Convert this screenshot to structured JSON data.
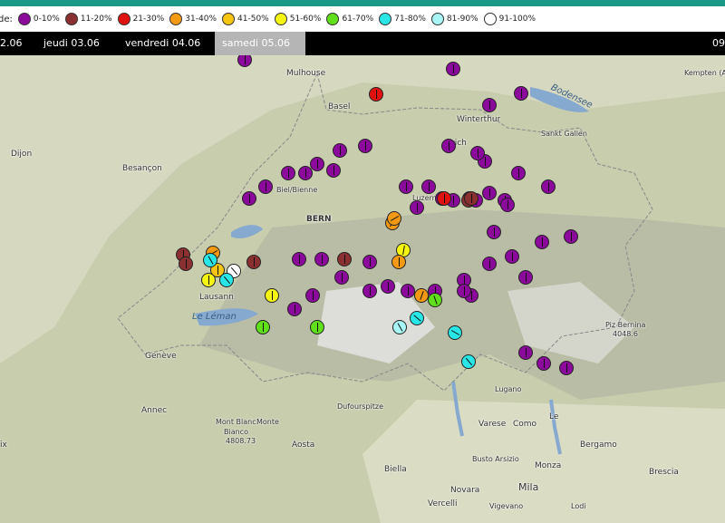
{
  "legend": {
    "label": "de:",
    "classes": [
      {
        "label": "0-10%",
        "color": "#8b0a9c"
      },
      {
        "label": "11-20%",
        "color": "#8b3030"
      },
      {
        "label": "21-30%",
        "color": "#e0120f"
      },
      {
        "label": "31-40%",
        "color": "#f39a12"
      },
      {
        "label": "41-50%",
        "color": "#f5c512"
      },
      {
        "label": "51-60%",
        "color": "#f5f512"
      },
      {
        "label": "61-70%",
        "color": "#5fe01a"
      },
      {
        "label": "71-80%",
        "color": "#29e6e6"
      },
      {
        "label": "81-90%",
        "color": "#a8f5f5"
      },
      {
        "label": "91-100%",
        "color": "#ffffff"
      }
    ]
  },
  "days": [
    {
      "label": "2.06",
      "selected": false
    },
    {
      "label": "jeudi 03.06",
      "selected": false
    },
    {
      "label": "vendredi 04.06",
      "selected": false
    },
    {
      "label": "samedi 05.06",
      "selected": true
    },
    {
      "label": "09",
      "selected": false
    }
  ],
  "places": {
    "mulhouse": "Mulhouse",
    "basel": "Basel",
    "winterthur": "Winterthur",
    "bodensee": "Bodensee",
    "zurich": "rich",
    "kempten": "Kempten (Allgäu)",
    "sanktgallen": "Sankt Gallen",
    "dijon": "Dijon",
    "besancon": "Besançon",
    "biel": "Biel/Bienne",
    "bern": "BERN",
    "luzern": "Luzern",
    "lausanne": "Lausann",
    "leman": "Le Léman",
    "geneve": "Genève",
    "annecy": "Annec",
    "montblanc": "Mont Blanc",
    "monte": "Monte",
    "bianco": "Bianco",
    "montblanc_alt": "4808.73",
    "aosta": "Aosta",
    "dufourspitze": "Dufourspitze",
    "pizbernina": "Piz Bernina",
    "pizbernina_alt": "4048.6",
    "lugano": "Lugano",
    "varese": "Varese",
    "como": "Como",
    "lecco": "Le",
    "bergamo": "Bergamo",
    "brescia": "Brescia",
    "biella": "Biella",
    "bustoarsizio": "Busto Arsizio",
    "monza": "Monza",
    "novara": "Novara",
    "milano": "Mila",
    "vercelli": "Vercelli",
    "vigevano": "Vigevano",
    "lodi": "Lodi",
    "aix": "ix"
  },
  "stations": [
    {
      "c": "#8b0a9c",
      "d": 0
    },
    {
      "c": "#8b0a9c",
      "d": 0
    },
    {
      "c": "#8b0a9c",
      "d": 0
    },
    {
      "c": "#8b0a9c",
      "d": 0
    },
    {
      "c": "#e0120f",
      "d": 0
    },
    {
      "c": "#8b0a9c",
      "d": 0
    },
    {
      "c": "#8b0a9c",
      "d": 0
    },
    {
      "c": "#8b0a9c",
      "d": 0
    },
    {
      "c": "#8b0a9c",
      "d": 0
    },
    {
      "c": "#8b0a9c",
      "d": 0
    },
    {
      "c": "#8b0a9c",
      "d": 0
    },
    {
      "c": "#8b0a9c",
      "d": 0
    },
    {
      "c": "#8b0a9c",
      "d": 0
    },
    {
      "c": "#8b0a9c",
      "d": 0
    },
    {
      "c": "#8b0a9c",
      "d": 0
    },
    {
      "c": "#8b0a9c",
      "d": 0
    },
    {
      "c": "#8b0a9c",
      "d": 0
    },
    {
      "c": "#8b0a9c",
      "d": 0
    },
    {
      "c": "#8b0a9c",
      "d": 0
    },
    {
      "c": "#8b0a9c",
      "d": 0
    },
    {
      "c": "#f39a12",
      "d": 40
    },
    {
      "c": "#8b0a9c",
      "d": 0
    },
    {
      "c": "#8b0a9c",
      "d": 0
    },
    {
      "c": "#8b0a9c",
      "d": 0
    },
    {
      "c": "#8b0a9c",
      "d": 0
    },
    {
      "c": "#8b3030",
      "d": 20
    },
    {
      "c": "#8b0a9c",
      "d": 0
    },
    {
      "c": "#8b0a9c",
      "d": 0
    },
    {
      "c": "#e0120f",
      "d": 0
    },
    {
      "c": "#8b3030",
      "d": 0
    },
    {
      "c": "#8b0a9c",
      "d": 0
    },
    {
      "c": "#8b0a9c",
      "d": 0
    },
    {
      "c": "#8b0a9c",
      "d": 0
    },
    {
      "c": "#f5f512",
      "d": 10
    },
    {
      "c": "#f39a12",
      "d": 60
    },
    {
      "c": "#f39a12",
      "d": 60
    },
    {
      "c": "#8b0a9c",
      "d": 0
    },
    {
      "c": "#8b0a9c",
      "d": 0
    },
    {
      "c": "#8b3030",
      "d": 0
    },
    {
      "c": "#8b0a9c",
      "d": 0
    },
    {
      "c": "#8b0a9c",
      "d": 0
    },
    {
      "c": "#8b0a9c",
      "d": 0
    },
    {
      "c": "#8b0a9c",
      "d": 0
    },
    {
      "c": "#8b0a9c",
      "d": 0
    },
    {
      "c": "#8b0a9c",
      "d": 0
    },
    {
      "c": "#f39a12",
      "d": 20
    },
    {
      "c": "#8b0a9c",
      "d": 0
    },
    {
      "c": "#8b0a9c",
      "d": 0
    },
    {
      "c": "#8b0a9c",
      "d": 0
    },
    {
      "c": "#8b0a9c",
      "d": 0
    },
    {
      "c": "#8b0a9c",
      "d": 0
    },
    {
      "c": "#5fe01a",
      "d": 0
    },
    {
      "c": "#8b0a9c",
      "d": 0
    },
    {
      "c": "#8b0a9c",
      "d": 0
    },
    {
      "c": "#f5f512",
      "d": 0
    },
    {
      "c": "#5fe01a",
      "d": 0
    },
    {
      "c": "#ffffff",
      "d": -40
    },
    {
      "c": "#8b3030",
      "d": 0
    },
    {
      "c": "#f5c512",
      "d": 0
    },
    {
      "c": "#f5f512",
      "d": 0
    },
    {
      "c": "#29e6e6",
      "d": -30
    },
    {
      "c": "#29e6e6",
      "d": -40
    },
    {
      "c": "#8b3030",
      "d": 0
    },
    {
      "c": "#8b3030",
      "d": 0
    },
    {
      "c": "#8b0a9c",
      "d": 0
    },
    {
      "c": "#8b0a9c",
      "d": 0
    },
    {
      "c": "#f39a12",
      "d": 0
    },
    {
      "c": "#5fe01a",
      "d": -20
    },
    {
      "c": "#29e6e6",
      "d": -50
    },
    {
      "c": "#8b0a9c",
      "d": 0
    },
    {
      "c": "#a8f5f5",
      "d": -30
    },
    {
      "c": "#29e6e6",
      "d": -60
    },
    {
      "c": "#29e6e6",
      "d": -40
    },
    {
      "c": "#8b0a9c",
      "d": 0
    },
    {
      "c": "#8b0a9c",
      "d": 0
    },
    {
      "c": "#8b0a9c",
      "d": 0
    }
  ]
}
